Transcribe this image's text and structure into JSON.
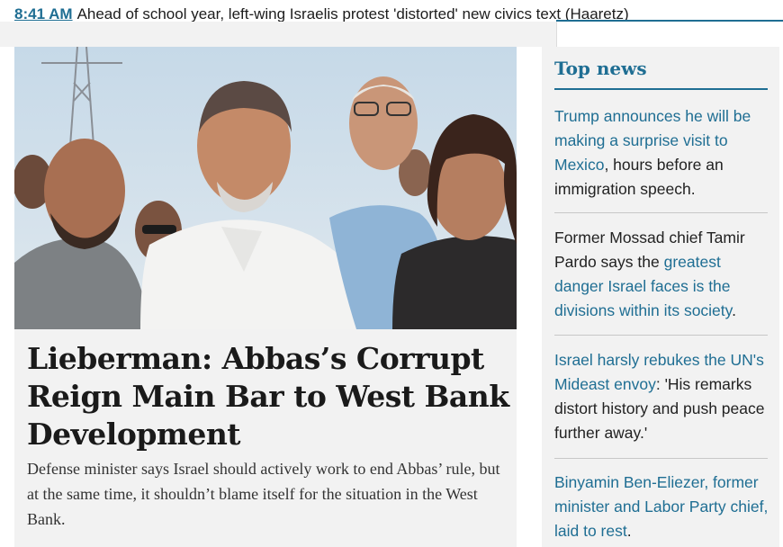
{
  "ticker": {
    "time": "8:41 AM",
    "text": "Ahead of school year, left-wing Israelis protest 'distorted' new civics text (Haaretz)"
  },
  "lead": {
    "headline": "Lieberman: Abbas’s Corrupt Reign Main Bar to West Bank Development",
    "dek": "Defense minister says Israel should actively work to end Abbas’ rule, but at the same time, it shouldn’t blame itself for the situation in the West Bank."
  },
  "top_news": {
    "title": "Top news",
    "items": [
      {
        "pre": "",
        "link": "Trump announces he will be making a surprise visit to Mexico",
        "post": ", hours before an immigration speech."
      },
      {
        "pre": "Former Mossad chief Tamir Pardo says the ",
        "link": "greatest danger Israel faces is the divisions within its society",
        "post": "."
      },
      {
        "pre": "",
        "link": "Israel harsly rebukes the UN's Mideast envoy",
        "post": ": 'His remarks distort history and push peace further away.'"
      },
      {
        "pre": "",
        "link": "Binyamin Ben-Eliezer, former minister and Labor Party chief, laid to rest",
        "post": "."
      }
    ]
  },
  "colors": {
    "accent": "#1f6e93",
    "panel": "#f2f2f2"
  }
}
